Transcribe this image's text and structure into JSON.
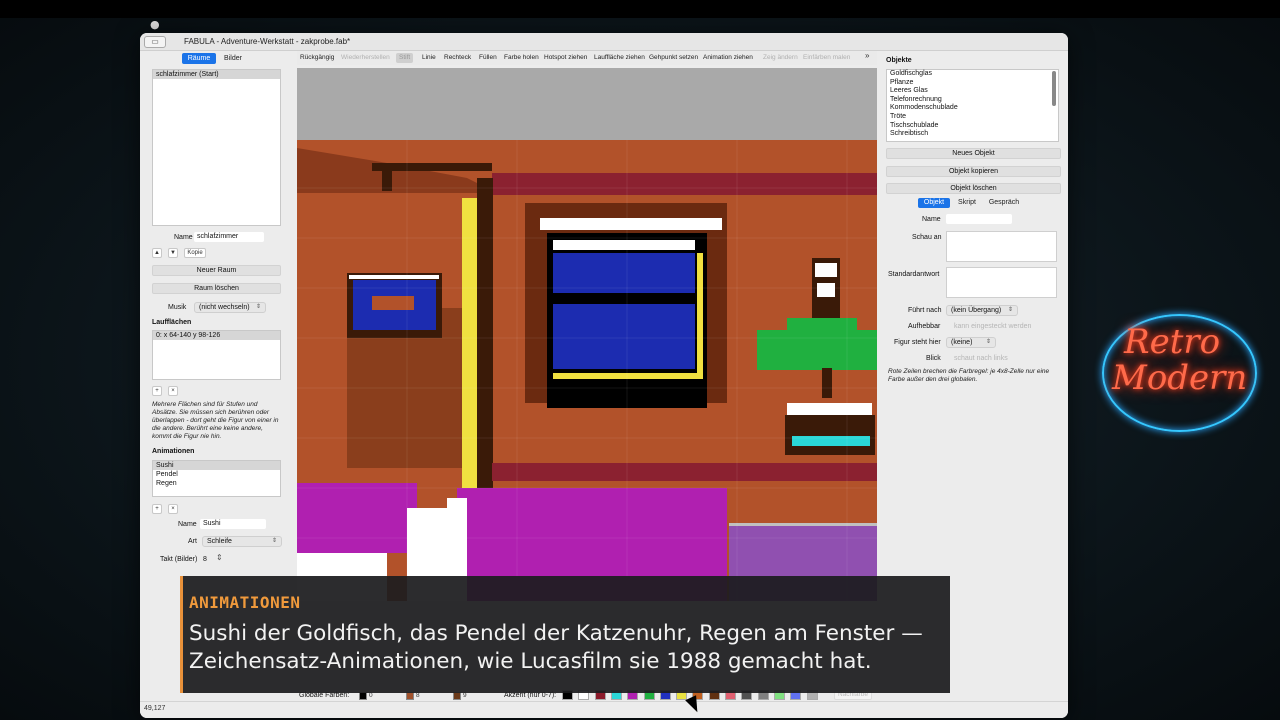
{
  "window": {
    "title": "FABULA - Adventure-Werkstatt - zakprobe.fab*"
  },
  "left": {
    "tabs": [
      "Räume",
      "Bilder"
    ],
    "rooms": [
      "schlafzimmer  (Start)"
    ],
    "name_label": "Name",
    "name_value": "schlafzimmer",
    "up": "▲",
    "down": "▼",
    "copy": "Kopie",
    "new_room": "Neuer Raum",
    "delete_room": "Raum löschen",
    "music_label": "Musik",
    "music_value": "(nicht wechseln)",
    "walk_areas_title": "Laufflächen",
    "walk_areas": [
      "0:  x 64-140   y 98-126"
    ],
    "add": "+",
    "remove": "×",
    "walk_help": "Mehrere Flächen sind für Stufen und Absätze. Sie müssen sich berühren oder überlappen - dort geht die Figur von einer in die andere. Berührt eine keine andere, kommt die Figur nie hin.",
    "anim_title": "Animationen",
    "animations": [
      "Sushi",
      "Pendel",
      "Regen"
    ],
    "anim_name_label": "Name",
    "anim_name_value": "Sushi",
    "anim_type_label": "Art",
    "anim_type_value": "Schleife",
    "anim_tact_label": "Takt (Bilder)",
    "anim_tact_value": "8"
  },
  "toolbar": {
    "items": [
      {
        "label": "Rückgängig",
        "state": "normal"
      },
      {
        "label": "Wiederherstellen",
        "state": "disabled"
      },
      {
        "label": "Stift",
        "state": "active"
      },
      {
        "label": "Linie",
        "state": "normal"
      },
      {
        "label": "Rechteck",
        "state": "normal"
      },
      {
        "label": "Füllen",
        "state": "normal"
      },
      {
        "label": "Farbe holen",
        "state": "normal"
      },
      {
        "label": "Hotspot ziehen",
        "state": "normal"
      },
      {
        "label": "Lauffläche ziehen",
        "state": "normal"
      },
      {
        "label": "Gehpunkt setzen",
        "state": "normal"
      },
      {
        "label": "Animation ziehen",
        "state": "normal"
      },
      {
        "label": "Zeig ändern",
        "state": "disabled"
      },
      {
        "label": "Einfärben malen",
        "state": "disabled"
      }
    ],
    "more": "»"
  },
  "right": {
    "objects_title": "Objekte",
    "objects": [
      "Goldfischglas",
      "Pflanze",
      "Leeres Glas",
      "Telefonrechnung",
      "Kommodenschublade",
      "Tröte",
      "Tischschublade",
      "Schreibtisch"
    ],
    "new_object": "Neues Objekt",
    "copy_object": "Objekt kopieren",
    "delete_object": "Objekt löschen",
    "tabs": [
      "Objekt",
      "Skript",
      "Gespräch"
    ],
    "name_label": "Name",
    "look_label": "Schau an",
    "default_label": "Standardantwort",
    "leads_label": "Führt nach",
    "leads_value": "(kein Übergang)",
    "pickup_label": "Aufhebbar",
    "pickup_placeholder": "kann eingesteckt werden",
    "figure_label": "Figur steht hier",
    "figure_value": "(keine)",
    "view_label": "Blick",
    "view_placeholder": "schaut nach links",
    "note": "Rote Zeilen brechen die Farbregel: je 4x8-Zelle nur eine Farbe außer den drei globalen."
  },
  "bottom": {
    "coords": "49,127",
    "global_label": "Globale Farben:",
    "global": [
      {
        "color": "#000000",
        "value": "0"
      },
      {
        "color": "#a0522d",
        "value": "8"
      },
      {
        "color": "#6b3a1a",
        "value": "9"
      }
    ],
    "accent_label": "Akzent (nur 0-7):",
    "accents": [
      "#000000",
      "#ffffff",
      "#8b1a2a",
      "#2ad7d7",
      "#b020b0",
      "#20b040",
      "#2030c0",
      "#e8e040",
      "#c06020",
      "#603010",
      "#e06070",
      "#505050",
      "#808080",
      "#80e080",
      "#6070f0",
      "#b0b0b0"
    ],
    "recolor": "Nachfarbe"
  },
  "caption": {
    "title": "ANIMATIONEN",
    "text": "Sushi der Goldfisch, das Pendel der Katzenuhr, Regen am Fenster — Zeichensatz-Animationen, wie Lucasfilm sie 1988 gemacht hat."
  },
  "logo": {
    "line1": "Retro",
    "line2": "Modern"
  }
}
